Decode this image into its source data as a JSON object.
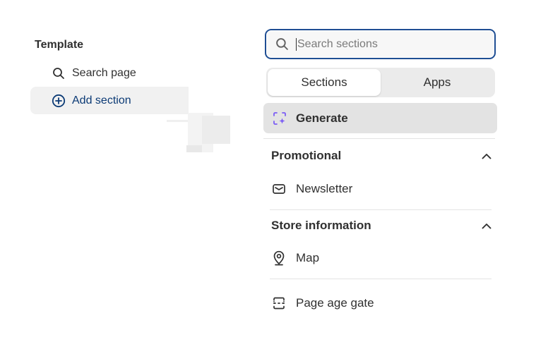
{
  "left_panel": {
    "heading": "Template",
    "items": [
      {
        "label": "Search page",
        "icon": "search-icon"
      },
      {
        "label": "Add section",
        "icon": "plus-circle-icon"
      }
    ]
  },
  "popover": {
    "search": {
      "placeholder": "Search sections",
      "value": ""
    },
    "tabs": [
      {
        "label": "Sections",
        "active": true
      },
      {
        "label": "Apps",
        "active": false
      }
    ],
    "generate": {
      "label": "Generate",
      "icon": "sparkle-icon"
    },
    "groups": [
      {
        "title": "Promotional",
        "expanded": true,
        "items": [
          {
            "label": "Newsletter",
            "icon": "envelope-icon"
          }
        ]
      },
      {
        "title": "Store information",
        "expanded": true,
        "items": [
          {
            "label": "Map",
            "icon": "map-pin-icon"
          }
        ]
      }
    ],
    "extra_items": [
      {
        "label": "Page age gate",
        "icon": "layout-section-icon"
      }
    ]
  },
  "colors": {
    "accent_navy": "#0b3a75",
    "focus_border": "#1f4e93",
    "generate_purple": "#7b5cf5"
  }
}
